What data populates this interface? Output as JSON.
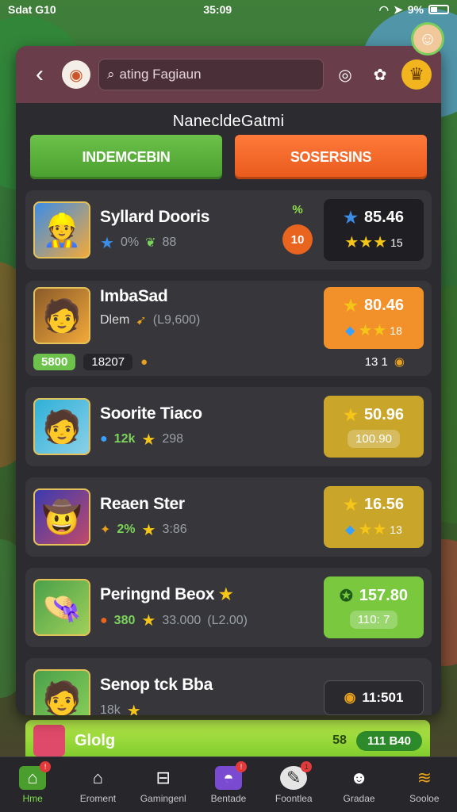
{
  "status_bar": {
    "left": "Sdat G10",
    "time": "35:09",
    "battery": "9%"
  },
  "header": {
    "search_placeholder": "ating Fagiaun"
  },
  "title": "NanecldeGatmi",
  "toggles": {
    "left": "INDEMCEBIN",
    "right": "SOSERSINS"
  },
  "cards": [
    {
      "name": "Syllard Dooris",
      "pct": "0%",
      "sub": "88",
      "badge_pct": "%",
      "badge_num": "10",
      "score": "85.46",
      "score_sub": "15",
      "box": "dark"
    },
    {
      "name": "ImbaSad",
      "line2": "Dlem",
      "line2b": "(L9,600)",
      "prog": "5800",
      "prog2": "18207",
      "right_num": "13 1",
      "score": "80.46",
      "score_sub": "18",
      "box": "orange"
    },
    {
      "name": "Soorite Tiaco",
      "pct": "12k",
      "sub": "298",
      "score": "50.96",
      "score_sub": "100.90",
      "box": "olive"
    },
    {
      "name": "Reaen Ster",
      "pct": "2%",
      "sub": "3:86",
      "score": "16.56",
      "score_sub": "13",
      "box": "olive"
    },
    {
      "name": "Peringnd Beox",
      "pct": "380",
      "sub": "33.000",
      "sub2": "(L2.00)",
      "score": "157.80",
      "score_sub": "110: 7",
      "box": "green"
    },
    {
      "name": "Senop tck Bba",
      "pct": "18k",
      "score": "11:501",
      "box": "slim"
    }
  ],
  "banner": {
    "name": "Glolg",
    "num": "58",
    "pill": "111 B40"
  },
  "nav": [
    {
      "label": "Hme",
      "icon": "home-icon"
    },
    {
      "label": "Eroment",
      "icon": "house-icon"
    },
    {
      "label": "Gamingenl",
      "icon": "controller-icon"
    },
    {
      "label": "Bentade",
      "icon": "helmet-icon"
    },
    {
      "label": "Foontlea",
      "icon": "trophy-icon"
    },
    {
      "label": "Gradae",
      "icon": "robot-icon"
    },
    {
      "label": "Sooloe",
      "icon": "layers-icon"
    }
  ]
}
